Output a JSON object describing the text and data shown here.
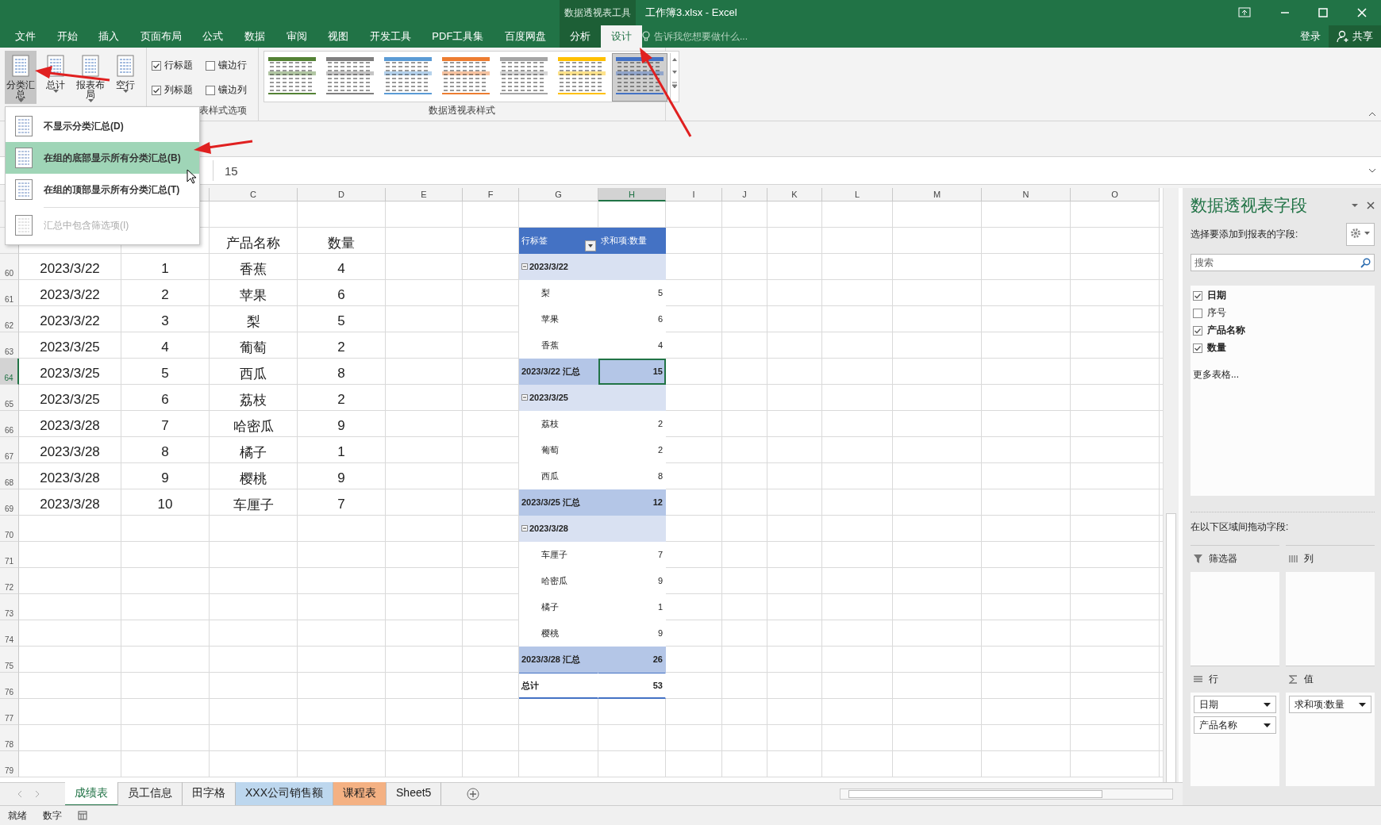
{
  "title_bar": {
    "context_label": "数据透视表工具",
    "title": "工作簿3.xlsx - Excel"
  },
  "ribbon_tabs": [
    {
      "label": "文件",
      "selected": false
    },
    {
      "label": "开始",
      "selected": false
    },
    {
      "label": "插入",
      "selected": false
    },
    {
      "label": "页面布局",
      "selected": false
    },
    {
      "label": "公式",
      "selected": false
    },
    {
      "label": "数据",
      "selected": false
    },
    {
      "label": "审阅",
      "selected": false
    },
    {
      "label": "视图",
      "selected": false
    },
    {
      "label": "开发工具",
      "selected": false
    },
    {
      "label": "PDF工具集",
      "selected": false
    },
    {
      "label": "百度网盘",
      "selected": false
    }
  ],
  "context_tabs": [
    {
      "label": "分析",
      "selected": false
    },
    {
      "label": "设计",
      "selected": true
    }
  ],
  "tell_me": {
    "placeholder": "告诉我您想要做什么..."
  },
  "account": {
    "sign_in": "登录",
    "share": "共享"
  },
  "layout_buttons": [
    {
      "lines": [
        "分类汇",
        "总"
      ],
      "pressed": true
    },
    {
      "lines": [
        "总计"
      ],
      "pressed": false
    },
    {
      "lines": [
        "报表布",
        "局"
      ],
      "pressed": false
    },
    {
      "lines": [
        "空行"
      ],
      "pressed": false
    }
  ],
  "style_options": {
    "group_label": "表样式选项",
    "checkboxes": [
      {
        "label": "行标题",
        "checked": true
      },
      {
        "label": "镶边行",
        "checked": false
      },
      {
        "label": "列标题",
        "checked": true
      },
      {
        "label": "镶边列",
        "checked": false
      }
    ]
  },
  "styles": {
    "group_label": "数据透视表样式",
    "swatches": [
      {
        "color": "#548235",
        "selected": false
      },
      {
        "color": "#7f7f7f",
        "selected": false
      },
      {
        "color": "#5b9bd5",
        "selected": false
      },
      {
        "color": "#ed7d31",
        "selected": false
      },
      {
        "color": "#a5a5a5",
        "selected": false
      },
      {
        "color": "#ffc000",
        "selected": false
      },
      {
        "color": "#4472c4",
        "selected": true
      }
    ]
  },
  "subtotals_menu": [
    {
      "label": "不显示分类汇总(D)",
      "selected": false,
      "disabled": false
    },
    {
      "label": "在组的底部显示所有分类汇总(B)",
      "selected": true,
      "disabled": false
    },
    {
      "label": "在组的顶部显示所有分类汇总(T)",
      "selected": false,
      "disabled": false
    },
    {
      "label": "汇总中包含筛选项(I)",
      "selected": false,
      "disabled": true
    }
  ],
  "formula_bar": {
    "value": "15"
  },
  "sheet": {
    "columns": [
      {
        "label": "C",
        "selected": false
      },
      {
        "label": "D",
        "selected": false
      },
      {
        "label": "E",
        "selected": false
      },
      {
        "label": "F",
        "selected": false
      },
      {
        "label": "G",
        "selected": false
      },
      {
        "label": "H",
        "selected": true
      },
      {
        "label": "I",
        "selected": false
      },
      {
        "label": "J",
        "selected": false
      },
      {
        "label": "K",
        "selected": false
      },
      {
        "label": "L",
        "selected": false
      },
      {
        "label": "M",
        "selected": false
      },
      {
        "label": "N",
        "selected": false
      },
      {
        "label": "O",
        "selected": false
      }
    ],
    "rows": [
      {
        "product": "产品名称",
        "quantity": "数量",
        "pivot": {
          "kind": "header",
          "label": "行标签",
          "value": "求和项:数量",
          "selected": false
        }
      },
      {
        "number": "60",
        "selected": false,
        "date": "2023/3/22",
        "seq": "1",
        "product": "香蕉",
        "quantity": "4",
        "pivot": {
          "kind": "group",
          "label": "2023/3/22",
          "selected": false
        }
      },
      {
        "number": "61",
        "selected": false,
        "date": "2023/3/22",
        "seq": "2",
        "product": "苹果",
        "quantity": "6",
        "pivot": {
          "kind": "item",
          "label": "梨",
          "value": "5",
          "selected": false
        }
      },
      {
        "number": "62",
        "selected": false,
        "date": "2023/3/22",
        "seq": "3",
        "product": "梨",
        "quantity": "5",
        "pivot": {
          "kind": "item",
          "label": "苹果",
          "value": "6",
          "selected": false
        }
      },
      {
        "number": "63",
        "selected": false,
        "date": "2023/3/25",
        "seq": "4",
        "product": "葡萄",
        "quantity": "2",
        "pivot": {
          "kind": "item",
          "label": "香蕉",
          "value": "4",
          "selected": false
        }
      },
      {
        "number": "64",
        "selected": true,
        "date": "2023/3/25",
        "seq": "5",
        "product": "西瓜",
        "quantity": "8",
        "pivot": {
          "kind": "subtotal",
          "label": "2023/3/22 汇总",
          "value": "15",
          "selected": true
        }
      },
      {
        "number": "65",
        "selected": false,
        "date": "2023/3/25",
        "seq": "6",
        "product": "荔枝",
        "quantity": "2",
        "pivot": {
          "kind": "group",
          "label": "2023/3/25",
          "selected": false
        }
      },
      {
        "number": "66",
        "selected": false,
        "date": "2023/3/28",
        "seq": "7",
        "product": "哈密瓜",
        "quantity": "9",
        "pivot": {
          "kind": "item",
          "label": "荔枝",
          "value": "2",
          "selected": false
        }
      },
      {
        "number": "67",
        "selected": false,
        "date": "2023/3/28",
        "seq": "8",
        "product": "橘子",
        "quantity": "1",
        "pivot": {
          "kind": "item",
          "label": "葡萄",
          "value": "2",
          "selected": false
        }
      },
      {
        "number": "68",
        "selected": false,
        "date": "2023/3/28",
        "seq": "9",
        "product": "樱桃",
        "quantity": "9",
        "pivot": {
          "kind": "item",
          "label": "西瓜",
          "value": "8",
          "selected": false
        }
      },
      {
        "number": "69",
        "selected": false,
        "date": "2023/3/28",
        "seq": "10",
        "product": "车厘子",
        "quantity": "7",
        "pivot": {
          "kind": "subtotal",
          "label": "2023/3/25 汇总",
          "value": "12",
          "selected": false
        }
      },
      {
        "number": "70",
        "selected": false,
        "pivot": {
          "kind": "group",
          "label": "2023/3/28",
          "selected": false
        }
      },
      {
        "number": "71",
        "selected": false,
        "pivot": {
          "kind": "item",
          "label": "车厘子",
          "value": "7",
          "selected": false
        }
      },
      {
        "number": "72",
        "selected": false,
        "pivot": {
          "kind": "item",
          "label": "哈密瓜",
          "value": "9",
          "selected": false
        }
      },
      {
        "number": "73",
        "selected": false,
        "pivot": {
          "kind": "item",
          "label": "橘子",
          "value": "1",
          "selected": false
        }
      },
      {
        "number": "74",
        "selected": false,
        "pivot": {
          "kind": "item",
          "label": "樱桃",
          "value": "9",
          "selected": false
        }
      },
      {
        "number": "75",
        "selected": false,
        "pivot": {
          "kind": "subtotal",
          "label": "2023/3/28 汇总",
          "value": "26",
          "selected": false
        }
      },
      {
        "number": "76",
        "selected": false,
        "pivot": {
          "kind": "total",
          "label": "总计",
          "value": "53",
          "selected": false
        }
      },
      {
        "number": "77",
        "selected": false
      },
      {
        "number": "78",
        "selected": false
      },
      {
        "number": "79",
        "selected": false
      }
    ]
  },
  "sheet_tabs": [
    {
      "label": "成绩表",
      "selected": true
    },
    {
      "label": "员工信息",
      "selected": false
    },
    {
      "label": "田字格",
      "selected": false
    },
    {
      "label": "XXX公司销售额",
      "selected": false,
      "color": "#bdd7ee"
    },
    {
      "label": "课程表",
      "selected": false,
      "color": "#f4b183"
    },
    {
      "label": "Sheet5",
      "selected": false
    }
  ],
  "status_bar": {
    "items": [
      "就绪",
      "数字"
    ]
  },
  "field_pane": {
    "title": "数据透视表字段",
    "subtitle": "选择要添加到报表的字段:",
    "search_placeholder": "搜索",
    "fields": [
      {
        "label": "日期",
        "checked": true
      },
      {
        "label": "序号",
        "checked": false
      },
      {
        "label": "产品名称",
        "checked": true
      },
      {
        "label": "数量",
        "checked": true
      }
    ],
    "more_tables": "更多表格...",
    "areas_hint": "在以下区域间拖动字段:",
    "areas": [
      {
        "kind": "filter",
        "label": "筛选器"
      },
      {
        "kind": "columns",
        "label": "列"
      },
      {
        "kind": "rows",
        "label": "行",
        "fields": [
          "日期",
          "产品名称"
        ]
      },
      {
        "kind": "values",
        "label": "值",
        "fields": [
          "求和项:数量"
        ]
      }
    ]
  }
}
